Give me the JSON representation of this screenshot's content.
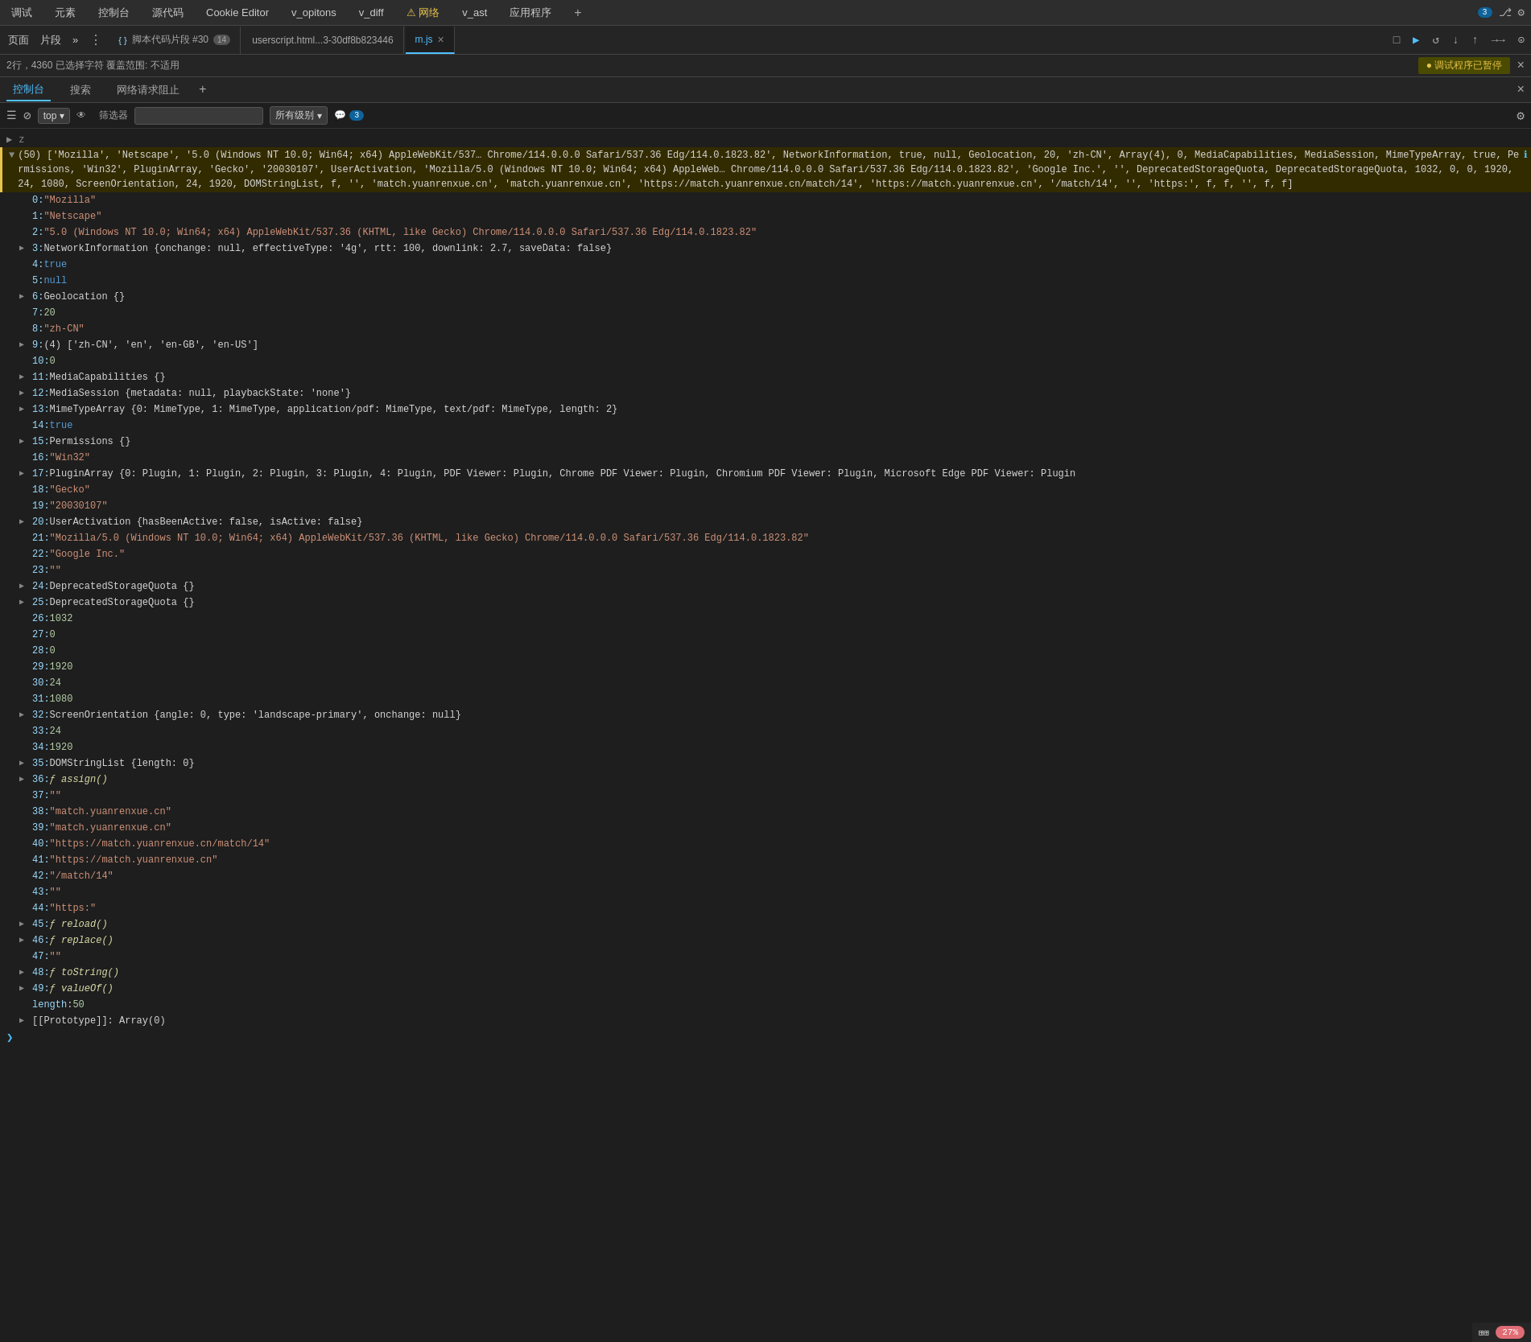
{
  "menubar": {
    "items": [
      "调试",
      "元素",
      "控制台",
      "源代码",
      "Cookie Editor",
      "v_opitons",
      "v_diff",
      "⚠ 网络",
      "v_ast",
      "应用程序",
      "+"
    ]
  },
  "tabs": {
    "nav_items": [
      "页面",
      "片段",
      "»"
    ],
    "overflow_icon": "⋮",
    "active_icon": "{ }",
    "items": [
      {
        "label": "脚本代码片段 #30",
        "count": "14",
        "active": false
      },
      {
        "label": "userscript.html...3-30df8b823446",
        "active": false
      },
      {
        "label": "m.js",
        "active": true,
        "closeable": true
      }
    ],
    "right_icons": [
      "□",
      "⟨⟩",
      "▶",
      "↺",
      "↓",
      "↑",
      "→→",
      "☌"
    ]
  },
  "statusbar": {
    "left": "2行，4360 已选择字符  覆盖范围: 不适用",
    "debug_badge": "● 调试程序已暂停"
  },
  "console_toolbar": {
    "tabs": [
      "控制台",
      "搜索",
      "网络请求阻止"
    ],
    "add": "+"
  },
  "filter_bar": {
    "icons": [
      "≡",
      "◌",
      "top",
      "👁",
      "筛选器"
    ],
    "dropdown_label": "top",
    "level_label": "所有级别",
    "count": "3"
  },
  "console": {
    "prompt_z": "z",
    "main_log": "(50) ['Mozilla', 'Netscape', '5.0 (Windows NT 10.0; Win64; x64) AppleWebKit/537… Chrome/114.0.0.0 Safari/537.36 Edg/114.0.1823.82', NetworkInformation, true, null, Geolocation, 20, 'zh-CN', Array(4), 0, MediaCapabilities, MediaSession, MimeTypeArray, true, Permissions, 'Win32', PluginArray, 'Gecko', '20030107', UserActivation, 'Mozilla/5.0 (Windows NT 10.0; Win64; x64) AppleWeb… Chrome/114.0.0.0 Safari/537.36 Edg/114.0.1823.82', 'Google Inc.', '', DeprecatedStorageQuota, DeprecatedStorageQuota, 1032, 0, 0, 1920, 24, 1080, ScreenOrientation, 24, 1920, DOMStringList, f, '', 'match.yuanrenxue.cn', 'match.yuanrenxue.cn', 'https://match.yuanrenxue.cn/match/14', 'https://match.yuanrenxue.cn', '/match/14', '', 'https:', f, f, '', f, f]",
    "items": [
      {
        "index": "0:",
        "value": "\"Mozilla\"",
        "type": "string",
        "indent": 1
      },
      {
        "index": "1:",
        "value": "\"Netscape\"",
        "type": "string",
        "indent": 1
      },
      {
        "index": "2:",
        "value": "\"5.0 (Windows NT 10.0; Win64; x64) AppleWebKit/537.36 (KHTML, like Gecko) Chrome/114.0.0.0 Safari/537.36 Edg/114.0.1823.82\"",
        "type": "string",
        "indent": 1
      },
      {
        "index": "3:",
        "value": "NetworkInformation {onchange: null, effectiveType: '4g', rtt: 100, downlink: 2.7, saveData: false}",
        "type": "object",
        "expandable": true,
        "indent": 1
      },
      {
        "index": "4:",
        "value": "true",
        "type": "keyword",
        "indent": 1
      },
      {
        "index": "5:",
        "value": "null",
        "type": "keyword",
        "indent": 1
      },
      {
        "index": "6:",
        "value": "Geolocation {}",
        "type": "object",
        "expandable": true,
        "indent": 1
      },
      {
        "index": "7:",
        "value": "20",
        "type": "number",
        "indent": 1
      },
      {
        "index": "8:",
        "value": "\"zh-CN\"",
        "type": "string",
        "indent": 1
      },
      {
        "index": "9:",
        "value": "(4) ['zh-CN', 'en', 'en-GB', 'en-US']",
        "type": "object",
        "expandable": true,
        "indent": 1
      },
      {
        "index": "10:",
        "value": "0",
        "type": "number",
        "indent": 1
      },
      {
        "index": "11:",
        "value": "MediaCapabilities {}",
        "type": "object",
        "expandable": true,
        "indent": 1
      },
      {
        "index": "12:",
        "value": "MediaSession {metadata: null, playbackState: 'none'}",
        "type": "object",
        "expandable": true,
        "indent": 1
      },
      {
        "index": "13:",
        "value": "MimeTypeArray {0: MimeType, 1: MimeType, application/pdf: MimeType, text/pdf: MimeType, length: 2}",
        "type": "object",
        "expandable": true,
        "indent": 1
      },
      {
        "index": "14:",
        "value": "true",
        "type": "keyword",
        "indent": 1
      },
      {
        "index": "15:",
        "value": "Permissions {}",
        "type": "object",
        "expandable": true,
        "indent": 1
      },
      {
        "index": "16:",
        "value": "\"Win32\"",
        "type": "string",
        "indent": 1
      },
      {
        "index": "17:",
        "value": "PluginArray {0: Plugin, 1: Plugin, 2: Plugin, 3: Plugin, 4: Plugin, PDF Viewer: Plugin, Chrome PDF Viewer: Plugin, Chromium PDF Viewer: Plugin, Microsoft Edge PDF Viewer: Plugin",
        "type": "object",
        "expandable": true,
        "indent": 1
      },
      {
        "index": "18:",
        "value": "\"Gecko\"",
        "type": "string",
        "indent": 1
      },
      {
        "index": "19:",
        "value": "\"20030107\"",
        "type": "string",
        "indent": 1
      },
      {
        "index": "20:",
        "value": "UserActivation {hasBeenActive: false, isActive: false}",
        "type": "object",
        "expandable": true,
        "indent": 1
      },
      {
        "index": "21:",
        "value": "\"Mozilla/5.0 (Windows NT 10.0; Win64; x64) AppleWebKit/537.36 (KHTML, like Gecko) Chrome/114.0.0.0 Safari/537.36 Edg/114.0.1823.82\"",
        "type": "string",
        "indent": 1
      },
      {
        "index": "22:",
        "value": "\"Google Inc.\"",
        "type": "string",
        "indent": 1
      },
      {
        "index": "23:",
        "value": "\"\"",
        "type": "string",
        "indent": 1
      },
      {
        "index": "24:",
        "value": "DeprecatedStorageQuota {}",
        "type": "object",
        "expandable": true,
        "indent": 1
      },
      {
        "index": "25:",
        "value": "DeprecatedStorageQuota {}",
        "type": "object",
        "expandable": true,
        "indent": 1
      },
      {
        "index": "26:",
        "value": "1032",
        "type": "number",
        "indent": 1
      },
      {
        "index": "27:",
        "value": "0",
        "type": "number",
        "indent": 1
      },
      {
        "index": "28:",
        "value": "0",
        "type": "number",
        "indent": 1
      },
      {
        "index": "29:",
        "value": "1920",
        "type": "number",
        "indent": 1
      },
      {
        "index": "30:",
        "value": "24",
        "type": "number",
        "indent": 1
      },
      {
        "index": "31:",
        "value": "1080",
        "type": "number",
        "indent": 1
      },
      {
        "index": "32:",
        "value": "ScreenOrientation {angle: 0, type: 'landscape-primary', onchange: null}",
        "type": "object",
        "expandable": true,
        "indent": 1
      },
      {
        "index": "33:",
        "value": "24",
        "type": "number",
        "indent": 1
      },
      {
        "index": "34:",
        "value": "1920",
        "type": "number",
        "indent": 1
      },
      {
        "index": "35:",
        "value": "DOMStringList {length: 0}",
        "type": "object",
        "expandable": true,
        "indent": 1
      },
      {
        "index": "36:",
        "value": "ƒ assign()",
        "type": "function",
        "expandable": true,
        "indent": 1
      },
      {
        "index": "37:",
        "value": "\"\"",
        "type": "string",
        "indent": 1
      },
      {
        "index": "38:",
        "value": "\"match.yuanrenxue.cn\"",
        "type": "string",
        "indent": 1
      },
      {
        "index": "39:",
        "value": "\"match.yuanrenxue.cn\"",
        "type": "string",
        "indent": 1
      },
      {
        "index": "40:",
        "value": "\"https://match.yuanrenxue.cn/match/14\"",
        "type": "string",
        "indent": 1
      },
      {
        "index": "41:",
        "value": "\"https://match.yuanrenxue.cn\"",
        "type": "string",
        "indent": 1
      },
      {
        "index": "42:",
        "value": "\"/match/14\"",
        "type": "string",
        "indent": 1
      },
      {
        "index": "43:",
        "value": "\"\"",
        "type": "string",
        "indent": 1
      },
      {
        "index": "44:",
        "value": "\"https:\"",
        "type": "string",
        "indent": 1
      },
      {
        "index": "45:",
        "value": "ƒ reload()",
        "type": "function",
        "expandable": true,
        "indent": 1
      },
      {
        "index": "46:",
        "value": "ƒ replace()",
        "type": "function",
        "expandable": true,
        "indent": 1
      },
      {
        "index": "47:",
        "value": "\"\"",
        "type": "string",
        "indent": 1
      },
      {
        "index": "48:",
        "value": "ƒ toString()",
        "type": "function",
        "expandable": true,
        "indent": 1
      },
      {
        "index": "49:",
        "value": "ƒ valueOf()",
        "type": "function",
        "expandable": true,
        "indent": 1
      }
    ],
    "length_line": "length: 50",
    "prototype_line": "[[Prototype]]: Array(0)"
  },
  "bottom": {
    "zoom": "27%",
    "prompt_arrow": ">"
  }
}
